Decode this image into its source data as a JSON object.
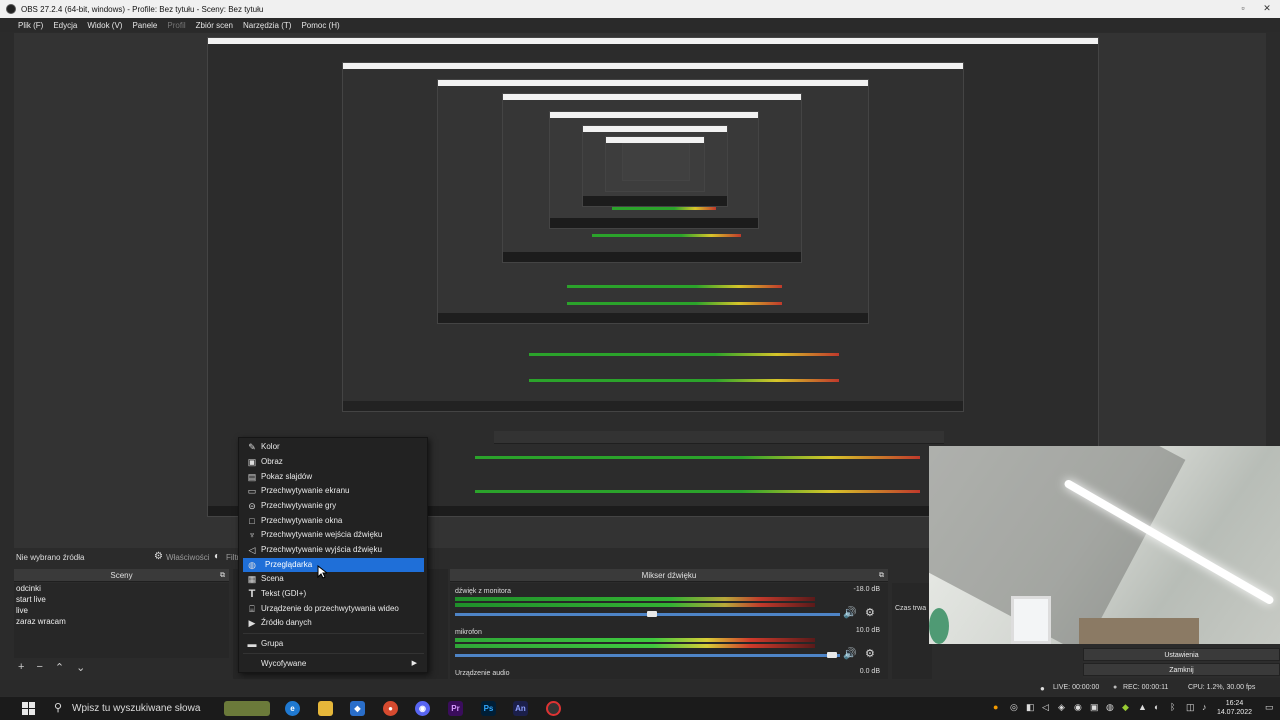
{
  "window": {
    "title": "OBS 27.2.4 (64-bit, windows) - Profile: Bez tytułu - Sceny: Bez tytułu"
  },
  "menu": {
    "items": [
      "Plik (F)",
      "Edycja",
      "Widok (V)",
      "Panele",
      "Profil",
      "Zbiór scen",
      "Narzędzia (T)",
      "Pomoc (H)"
    ]
  },
  "sources": {
    "no_source_label": "Nie wybrano źródła",
    "properties_label": "Właściwości",
    "filters_label": "Filtry"
  },
  "scenes": {
    "header": "Sceny",
    "items": [
      "odcinki",
      "start live",
      "live",
      "zaraz wracam"
    ]
  },
  "mixer": {
    "header": "Mikser dźwięku",
    "tracks": [
      {
        "name": "dźwięk z monitora",
        "db": "-18.0 dB",
        "level": 0.72,
        "volume": 0.52
      },
      {
        "name": "mikrofon",
        "db": "10.0 dB",
        "level": 0.82,
        "volume": 0.98
      },
      {
        "name": "Urządzenie audio",
        "db": "0.0 dB"
      }
    ]
  },
  "transitions": {
    "duration_label": "Czas trwa"
  },
  "context_menu": {
    "items": [
      {
        "label": "Kolor",
        "icon": "color-icon"
      },
      {
        "label": "Obraz",
        "icon": "image-icon"
      },
      {
        "label": "Pokaz slajdów",
        "icon": "slideshow-icon"
      },
      {
        "label": "Przechwytywanie ekranu",
        "icon": "monitor-icon"
      },
      {
        "label": "Przechwytywanie gry",
        "icon": "gamepad-icon"
      },
      {
        "label": "Przechwytywanie okna",
        "icon": "window-icon"
      },
      {
        "label": "Przechwytywanie wejścia dźwięku",
        "icon": "microphone-icon"
      },
      {
        "label": "Przechwytywanie wyjścia dźwięku",
        "icon": "speaker-icon"
      },
      {
        "label": "Przeglądarka",
        "icon": "globe-icon"
      },
      {
        "label": "Scena",
        "icon": "scene-icon"
      },
      {
        "label": "Tekst (GDI+)",
        "icon": "text-icon"
      },
      {
        "label": "Urządzenie do przechwytywania wideo",
        "icon": "camera-icon"
      },
      {
        "label": "Źródło danych",
        "icon": "play-icon"
      },
      {
        "label": "Grupa",
        "icon": "folder-icon"
      },
      {
        "label": "Wycofywane",
        "icon": ""
      }
    ],
    "selected": "Przeglądarka"
  },
  "controls": {
    "settings_label": "Ustawienia",
    "exit_label": "Zamknij"
  },
  "status": {
    "live": "LIVE: 00:00:00",
    "rec": "REC: 00:00:11",
    "cpu": "CPU: 1.2%, 30.00 fps"
  },
  "taskbar": {
    "search_placeholder": "Wpisz tu wyszukiwane słowa",
    "time": "16:24",
    "date": "14.07.2022"
  }
}
